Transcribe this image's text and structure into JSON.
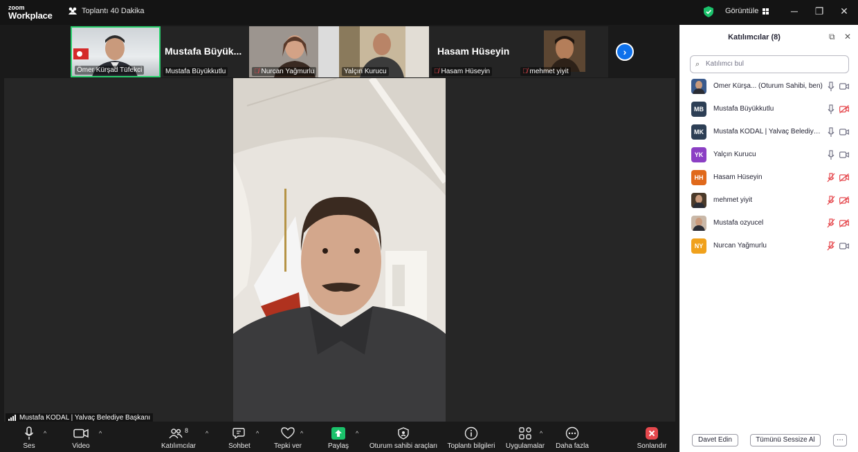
{
  "app": {
    "logo_line1": "zoom",
    "logo_line2": "Workplace",
    "meeting_title": "Toplantı 40 Dakika",
    "view_label": "Görüntüle"
  },
  "thumbnails": [
    {
      "name": "Ömer Kürşad Tüfekci",
      "mic_muted": false,
      "active": true
    },
    {
      "name": "Mustafa Büyükkutlu",
      "display": "Mustafa  Büyük...",
      "mic_muted": false
    },
    {
      "name": "Nurcan Yağmurlu",
      "mic_muted": true
    },
    {
      "name": "Yalçın Kurucu",
      "mic_muted": false
    },
    {
      "name": "Hasam Hüseyin",
      "display": "Hasam Hüseyin",
      "mic_muted": true
    },
    {
      "name": "mehmet yiyit",
      "mic_muted": true
    }
  ],
  "speaker": {
    "label": "Mustafa KODAL | Yalvaç Belediye Başkanı"
  },
  "toolbar": {
    "audio": "Ses",
    "video": "Video",
    "participants": "Katılımcılar",
    "participants_count": "8",
    "chat": "Sohbet",
    "react": "Tepki ver",
    "share": "Paylaş",
    "host_tools": "Oturum sahibi araçları",
    "meeting_info": "Toplantı bilgileri",
    "apps": "Uygulamalar",
    "more": "Daha fazla",
    "end": "Sonlandır"
  },
  "panel": {
    "title": "Katılımcılar (8)",
    "search_placeholder": "Katılımcı bul",
    "invite_label": "Davet Edin",
    "mute_all_label": "Tümünü Sessize Al",
    "participants": [
      {
        "name": "Ömer Kürşa...  (Oturum Sahibi, ben)",
        "initials": "",
        "color": "#3a5a8c",
        "photo": true,
        "mic": "on",
        "cam": "on"
      },
      {
        "name": "Mustafa Büyükkutlu",
        "initials": "MB",
        "color": "#2d3f55",
        "photo": false,
        "mic": "on",
        "cam": "off"
      },
      {
        "name": "Mustafa KODAL | Yalvaç Belediye ...",
        "initials": "MK",
        "color": "#2d3f55",
        "photo": false,
        "mic": "on",
        "cam": "on"
      },
      {
        "name": "Yalçın Kurucu",
        "initials": "YK",
        "color": "#8b3fc4",
        "photo": false,
        "mic": "on",
        "cam": "on"
      },
      {
        "name": "Hasam Hüseyin",
        "initials": "HH",
        "color": "#e0691b",
        "photo": false,
        "mic": "off",
        "cam": "off"
      },
      {
        "name": "mehmet yiyit",
        "initials": "",
        "color": "#4a3a2a",
        "photo": true,
        "mic": "off",
        "cam": "off"
      },
      {
        "name": "Mustafa ozyucel",
        "initials": "",
        "color": "#c9b8a8",
        "photo": true,
        "mic": "off",
        "cam": "off"
      },
      {
        "name": "Nurcan Yağmurlu",
        "initials": "NY",
        "color": "#f0a11c",
        "photo": false,
        "mic": "off",
        "cam": "on"
      }
    ]
  },
  "colors": {
    "accent": "#0e71eb",
    "share_green": "#1bc26b",
    "muted_red": "#e5484d",
    "active_border": "#2ad16e"
  }
}
